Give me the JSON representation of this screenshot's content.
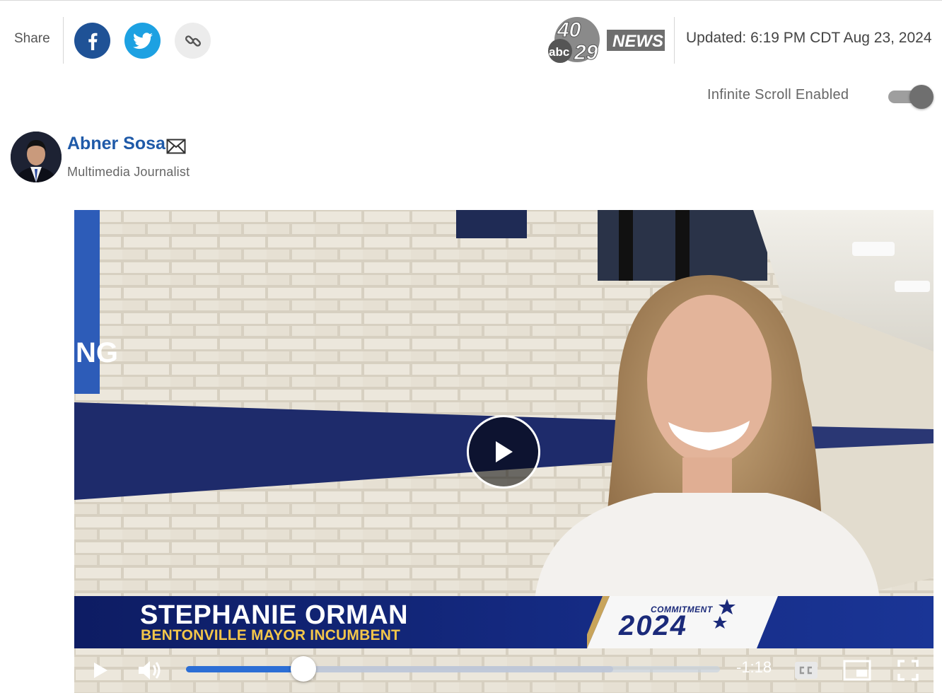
{
  "share": {
    "label": "Share",
    "buttons": [
      {
        "name": "facebook-icon",
        "color": "#1f5296"
      },
      {
        "name": "twitter-icon",
        "color": "#1da1e2"
      },
      {
        "name": "link-icon",
        "color": "#ececec"
      }
    ]
  },
  "logo": {
    "channel_top": "40",
    "channel_bottom": "29",
    "network": "abc",
    "news": "NEWS"
  },
  "updated": "Updated: 6:19 PM CDT Aug 23, 2024",
  "infinite_scroll": {
    "label": "Infinite Scroll Enabled",
    "enabled": true
  },
  "author": {
    "name": "Abner Sosa",
    "title": "Multimedia Journalist"
  },
  "video": {
    "lower_third": {
      "name": "STEPHANIE ORMAN",
      "role": "BENTONVILLE MAYOR INCUMBENT",
      "badge_top": "COMMITMENT",
      "badge_year": "2024"
    },
    "sign_text": "NG",
    "time_remaining": "-1:18",
    "progress_fraction": 0.22,
    "buffered_fraction": 0.8,
    "colors": {
      "lower_third": "#152b84",
      "role_text": "#f3c64a",
      "progress": "#2c6ed5"
    }
  }
}
